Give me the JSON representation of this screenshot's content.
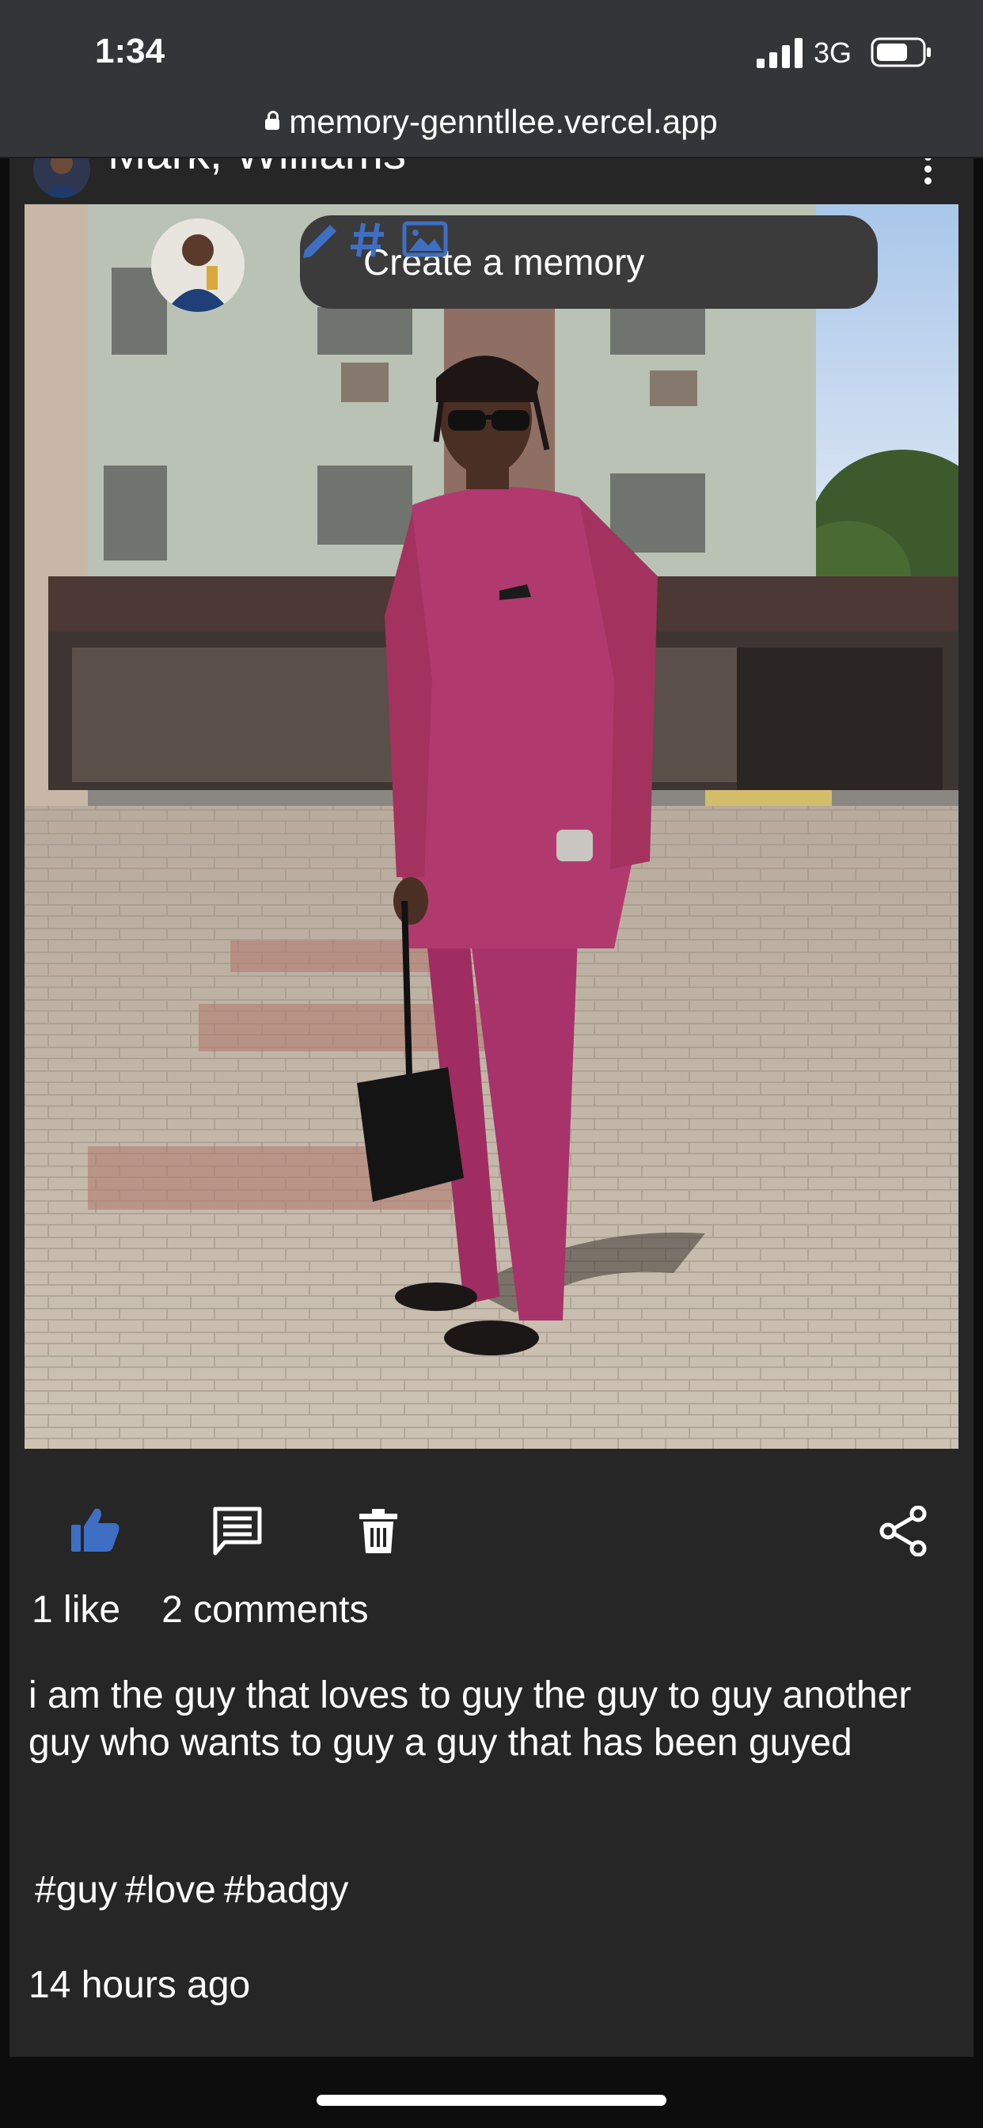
{
  "status_bar": {
    "time": "1:34",
    "network": "3G"
  },
  "url_bar": {
    "url": "memory-genntllee.vercel.app"
  },
  "post": {
    "author": "Mark, Williams",
    "create_memory_label": "Create a memory",
    "likes_text": "1 like",
    "comments_text": "2 comments",
    "caption": "i am the guy that loves to guy the guy to guy another guy who wants to guy a guy that has been guyed",
    "tags": [
      "#guy",
      "#love",
      "#badgy"
    ],
    "time_ago": "14 hours ago"
  },
  "icons": {
    "like": "thumbs-up-icon",
    "comment": "comment-icon",
    "delete": "trash-icon",
    "share": "share-icon",
    "pencil": "pencil-icon",
    "hash": "hashtag-icon",
    "image": "image-icon"
  },
  "colors": {
    "accent_blue": "#3f6fc4",
    "card_bg": "#262626",
    "status_bg": "#343538",
    "outfit": "#b03a6e"
  }
}
